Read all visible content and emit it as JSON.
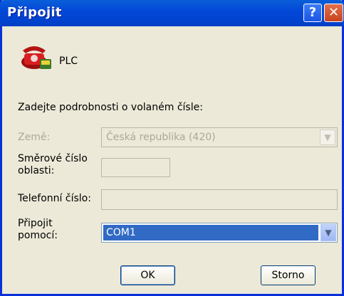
{
  "window": {
    "title": "Připojit",
    "help_label": "?",
    "close_label": "✕"
  },
  "entry": {
    "name": "PLC",
    "icon": "phone-icon"
  },
  "prompt": "Zadejte podrobnosti o volaném čísle:",
  "fields": {
    "country_label": "Země:",
    "country_value": "Česká republika (420)",
    "area_label": "Směrové číslo oblasti:",
    "area_value": "",
    "phone_label": "Telefonní číslo:",
    "phone_value": "",
    "connect_label": "Připojit pomocí:",
    "connect_value": "COM1"
  },
  "buttons": {
    "ok": "OK",
    "cancel": "Storno"
  },
  "colors": {
    "titlebar": "#0348d8",
    "selection": "#316ac5",
    "dialog_bg": "#ece9d8"
  }
}
